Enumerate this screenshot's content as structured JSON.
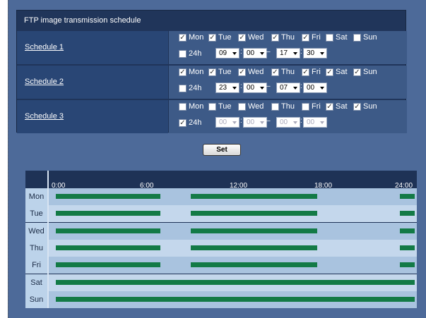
{
  "panel": {
    "title": "FTP image transmission schedule"
  },
  "days": [
    "Mon",
    "Tue",
    "Wed",
    "Thu",
    "Fri",
    "Sat",
    "Sun"
  ],
  "twentyfour_label": "24h",
  "dash": "–",
  "schedules": [
    {
      "label": "Schedule 1",
      "checked": [
        true,
        true,
        true,
        true,
        true,
        false,
        false
      ],
      "all_day": false,
      "start_hour": "09",
      "start_min": "00",
      "end_hour": "17",
      "end_min": "30",
      "enabled": true
    },
    {
      "label": "Schedule 2",
      "checked": [
        true,
        true,
        true,
        true,
        true,
        true,
        true
      ],
      "all_day": false,
      "start_hour": "23",
      "start_min": "00",
      "end_hour": "07",
      "end_min": "00",
      "enabled": true
    },
    {
      "label": "Schedule 3",
      "checked": [
        false,
        false,
        false,
        false,
        false,
        true,
        true
      ],
      "all_day": true,
      "start_hour": "00",
      "start_min": "00",
      "end_hour": "00",
      "end_min": "00",
      "enabled": false
    }
  ],
  "set_button": "Set",
  "timeline": {
    "ticks": [
      "0:00",
      "6:00",
      "12:00",
      "18:00",
      "24:00"
    ],
    "day_labels": [
      "Mon",
      "Tue",
      "Wed",
      "Thu",
      "Fri",
      "Sat",
      "Sun"
    ],
    "bars": [
      [
        [
          0,
          7
        ],
        [
          9,
          17.5
        ],
        [
          23,
          24
        ]
      ],
      [
        [
          0,
          7
        ],
        [
          9,
          17.5
        ],
        [
          23,
          24
        ]
      ],
      [
        [
          0,
          7
        ],
        [
          9,
          17.5
        ],
        [
          23,
          24
        ]
      ],
      [
        [
          0,
          7
        ],
        [
          9,
          17.5
        ],
        [
          23,
          24
        ]
      ],
      [
        [
          0,
          7
        ],
        [
          9,
          17.5
        ],
        [
          23,
          24
        ]
      ],
      [
        [
          0,
          24
        ]
      ],
      [
        [
          0,
          24
        ]
      ]
    ],
    "bar_color": "#137a46",
    "row_colors": [
      "#a9c3df",
      "#c4d7ec"
    ]
  }
}
